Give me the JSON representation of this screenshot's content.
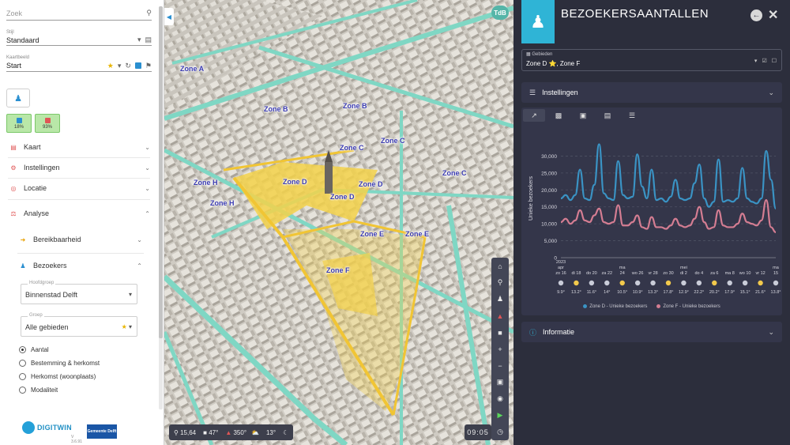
{
  "sidebar": {
    "search_placeholder": "Zoek",
    "stijl_label": "Stijl",
    "stijl_value": "Standaard",
    "kaartbeeld_label": "Kaartbeeld",
    "kaartbeeld_value": "Start",
    "pct1": "18%",
    "pct2": "93%",
    "menu": [
      {
        "label": "Kaart",
        "icon": "map-icon"
      },
      {
        "label": "Instellingen",
        "icon": "gear-icon"
      },
      {
        "label": "Locatie",
        "icon": "location-icon"
      },
      {
        "label": "Analyse",
        "icon": "flask-icon"
      }
    ],
    "sub_bereikbaarheid": "Bereikbaarheid",
    "sub_bezoekers": "Bezoekers",
    "hoofdgroep_label": "Hoofdgroep",
    "hoofdgroep_value": "Binnenstad Delft",
    "groep_label": "Groep",
    "groep_value": "Alle gebieden",
    "radios": [
      "Aantal",
      "Bestemming & herkomst",
      "Herkomst (woonplaats)",
      "Modaliteit"
    ],
    "logo_name": "DIGITWIN",
    "version": "V 3.6.91",
    "gemeente_logo": "Gemeente Delft"
  },
  "map": {
    "tdb": "TdB",
    "zones": [
      "Zone A",
      "Zone B",
      "Zone B",
      "Zone C",
      "Zone C",
      "Zone C",
      "Zone H",
      "Zone H",
      "Zone D",
      "Zone D",
      "Zone D",
      "Zone E",
      "Zone E",
      "Zone F"
    ],
    "stats": {
      "zoom": "15,64",
      "tilt": "47°",
      "heading": "350°"
    },
    "weather_temp": "13°",
    "time": "09:05"
  },
  "panel": {
    "title": "BEZOEKERSAANTALLEN",
    "gebieden_label": "Gebieden",
    "gebieden_value": "Zone D ⭐, Zone F",
    "instellingen": "Instellingen",
    "informatie": "Informatie",
    "colors": {
      "zoneD": "#3a93c4",
      "zoneF": "#d47d92",
      "accent": "#2fb4d6"
    }
  },
  "chart_data": {
    "type": "line",
    "ylabel": "Unieke bezoekers",
    "ylim": [
      0,
      35000
    ],
    "yticks": [
      "0",
      "5,000",
      "10,000",
      "15,000",
      "20,000",
      "25,000",
      "30,000"
    ],
    "xticks": [
      {
        "l1": "apr",
        "l2": "zo 16",
        "yr": "2023"
      },
      {
        "l1": "",
        "l2": "di 18"
      },
      {
        "l1": "",
        "l2": "do 20"
      },
      {
        "l1": "",
        "l2": "za 22"
      },
      {
        "l1": "ma",
        "l2": "24"
      },
      {
        "l1": "",
        "l2": "wo 26"
      },
      {
        "l1": "",
        "l2": "vr 28"
      },
      {
        "l1": "",
        "l2": "zo 30"
      },
      {
        "l1": "mei",
        "l2": "di 2"
      },
      {
        "l1": "",
        "l2": "do 4"
      },
      {
        "l1": "",
        "l2": "za 6"
      },
      {
        "l1": "",
        "l2": "ma 8"
      },
      {
        "l1": "",
        "l2": "wo 10"
      },
      {
        "l1": "",
        "l2": "vr 12"
      },
      {
        "l1": "ma",
        "l2": "15"
      }
    ],
    "temps": [
      "9.9°",
      "13.2°",
      "11.6°",
      "14°",
      "10.5°",
      "10.9°",
      "13.3°",
      "17.8°",
      "12.9°",
      "22.2°",
      "20.2°",
      "17.9°",
      "15.1°",
      "21.6°",
      "13.8°"
    ],
    "series": [
      {
        "name": "Zone D - Unieke bezoekers",
        "color": "#3a93c4",
        "values": [
          17500,
          18500,
          17000,
          18500,
          26000,
          17500,
          17000,
          21500,
          33500,
          19000,
          17500,
          17000,
          28500,
          18500,
          17500,
          18000,
          30500,
          21000,
          17500,
          26000,
          17000,
          17500,
          16500,
          18000,
          23000,
          17500,
          17000,
          17500,
          22000,
          27500,
          17500,
          15000,
          16500,
          29000,
          16500,
          17000,
          16500,
          17500,
          26500,
          17500,
          16500,
          16000,
          17500,
          31500,
          23000,
          14500
        ]
      },
      {
        "name": "Zone F - Unieke bezoekers",
        "color": "#d47d92",
        "values": [
          10500,
          11500,
          10000,
          11000,
          14000,
          11000,
          10500,
          12500,
          14500,
          10500,
          10000,
          10500,
          15500,
          9500,
          9500,
          10500,
          12500,
          9000,
          8500,
          12000,
          9000,
          9000,
          8500,
          9500,
          11500,
          9500,
          9000,
          9500,
          11500,
          15000,
          10500,
          8500,
          9000,
          14000,
          9500,
          9000,
          9000,
          10000,
          13000,
          10500,
          10000,
          9500,
          11000,
          17000,
          9000,
          7500
        ]
      }
    ]
  }
}
